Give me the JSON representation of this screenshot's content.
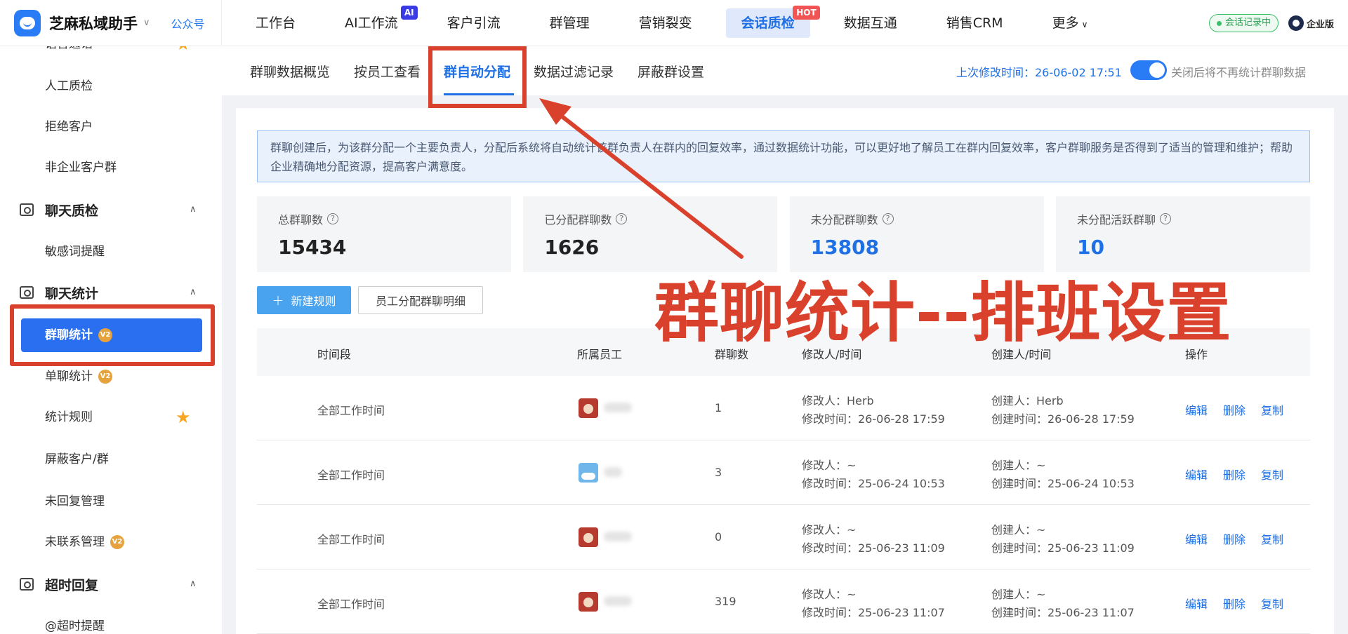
{
  "header": {
    "brand_name": "芝麻私域助手",
    "brand_caret": "∨",
    "brand_link": "公众号",
    "nav": [
      {
        "label": "工作台"
      },
      {
        "label": "AI工作流",
        "badge": "AI"
      },
      {
        "label": "客户引流"
      },
      {
        "label": "群管理"
      },
      {
        "label": "营销裂变"
      },
      {
        "label": "会话质检",
        "badge": "HOT",
        "active": true
      },
      {
        "label": "数据互通"
      },
      {
        "label": "销售CRM"
      },
      {
        "label": "更多"
      }
    ],
    "record_status": "会话记录中",
    "enterprise_label": "企业版"
  },
  "sidebar": {
    "items_top": [
      "语音通话",
      "人工质检",
      "拒绝客户",
      "非企业客户群"
    ],
    "group_chat_qc": "聊天质检",
    "sensitive": "敏感词提醒",
    "group_chat_stats": "聊天统计",
    "active_item": "群聊统计",
    "badge_v2": "V2",
    "items_stats": [
      "单聊统计",
      "统计规则",
      "屏蔽客户/群",
      "未回复管理",
      "未联系管理"
    ],
    "group_timeout": "超时回复",
    "timeout_item": "@超时提醒"
  },
  "subtabs": {
    "tabs": [
      "群聊数据概览",
      "按员工查看",
      "群自动分配",
      "数据过滤记录",
      "屏蔽群设置"
    ],
    "active_index": 2,
    "last_modified": "上次修改时间：26-06-02 17:51",
    "toggle_note": "关闭后将不再统计群聊数据"
  },
  "notice": "群聊创建后，为该群分配一个主要负责人，分配后系统将自动统计该群负责人在群内的回复效率，通过数据统计功能，可以更好地了解员工在群内回复效率，客户群聊服务是否得到了适当的管理和维护；帮助企业精确地分配资源，提高客户满意度。",
  "stats": [
    {
      "label": "总群聊数",
      "value": "15434",
      "highlight": false
    },
    {
      "label": "已分配群聊数",
      "value": "1626",
      "highlight": false
    },
    {
      "label": "未分配群聊数",
      "value": "13808",
      "highlight": true
    },
    {
      "label": "未分配活跃群聊",
      "value": "10",
      "highlight": true
    }
  ],
  "buttons": {
    "new_rule": "新建规则",
    "detail": "员工分配群聊明细"
  },
  "table": {
    "headers": [
      "时间段",
      "所属员工",
      "群聊数",
      "修改人/时间",
      "创建人/时间",
      "操作"
    ],
    "rows": [
      {
        "period": "全部工作时间",
        "avatar": "red",
        "count": "1",
        "mod_by": "修改人：Herb",
        "mod_time": "修改时间：26-06-28 17:59",
        "create_by": "创建人：Herb",
        "create_time": "创建时间：26-06-28 17:59"
      },
      {
        "period": "全部工作时间",
        "avatar": "sky",
        "count": "3",
        "mod_by": "修改人：~",
        "mod_time": "修改时间：25-06-24 10:53",
        "create_by": "创建人：~",
        "create_time": "创建时间：25-06-24 10:53"
      },
      {
        "period": "全部工作时间",
        "avatar": "red",
        "count": "0",
        "mod_by": "修改人：~",
        "mod_time": "修改时间：25-06-23 11:09",
        "create_by": "创建人：~",
        "create_time": "创建时间：25-06-23 11:09"
      },
      {
        "period": "全部工作时间",
        "avatar": "red",
        "count": "319",
        "mod_by": "修改人：~",
        "mod_time": "修改时间：25-06-23 11:07",
        "create_by": "创建人：~",
        "create_time": "创建时间：25-06-23 11:07"
      }
    ],
    "ops": [
      "编辑",
      "删除",
      "复制"
    ]
  },
  "annotation": {
    "title": "群聊统计--排班设置"
  },
  "colors": {
    "primary": "#2a6ff0",
    "annotation": "#d9412c"
  }
}
